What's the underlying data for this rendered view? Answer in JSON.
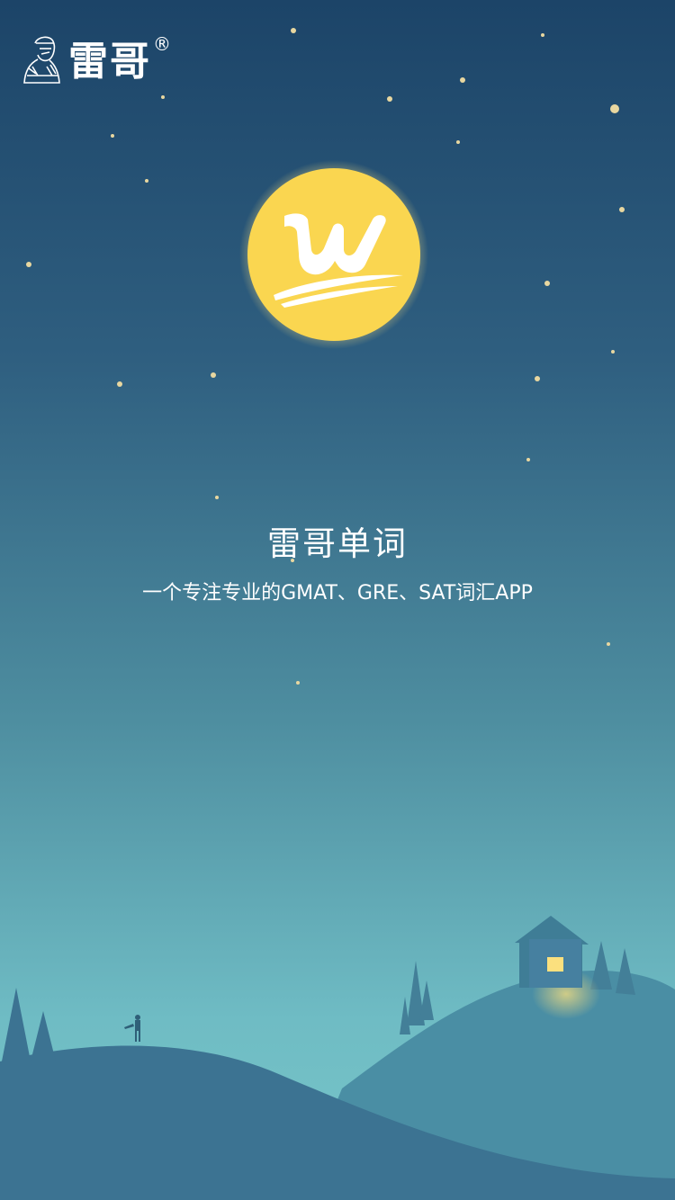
{
  "brand": {
    "name": "雷哥",
    "registered_mark": "®"
  },
  "app": {
    "title": "雷哥单词",
    "tagline": "一个专注专业的GMAT、GRE、SAT词汇APP"
  },
  "logo": {
    "icon": "w-letter-moon-icon",
    "letter": "w"
  },
  "colors": {
    "sky_top": "#1c4468",
    "sky_bottom": "#78c6c8",
    "moon": "#fad650",
    "hill_back": "#4a8ea4",
    "hill_front": "#3c7392",
    "window_light": "#fbe07e"
  }
}
